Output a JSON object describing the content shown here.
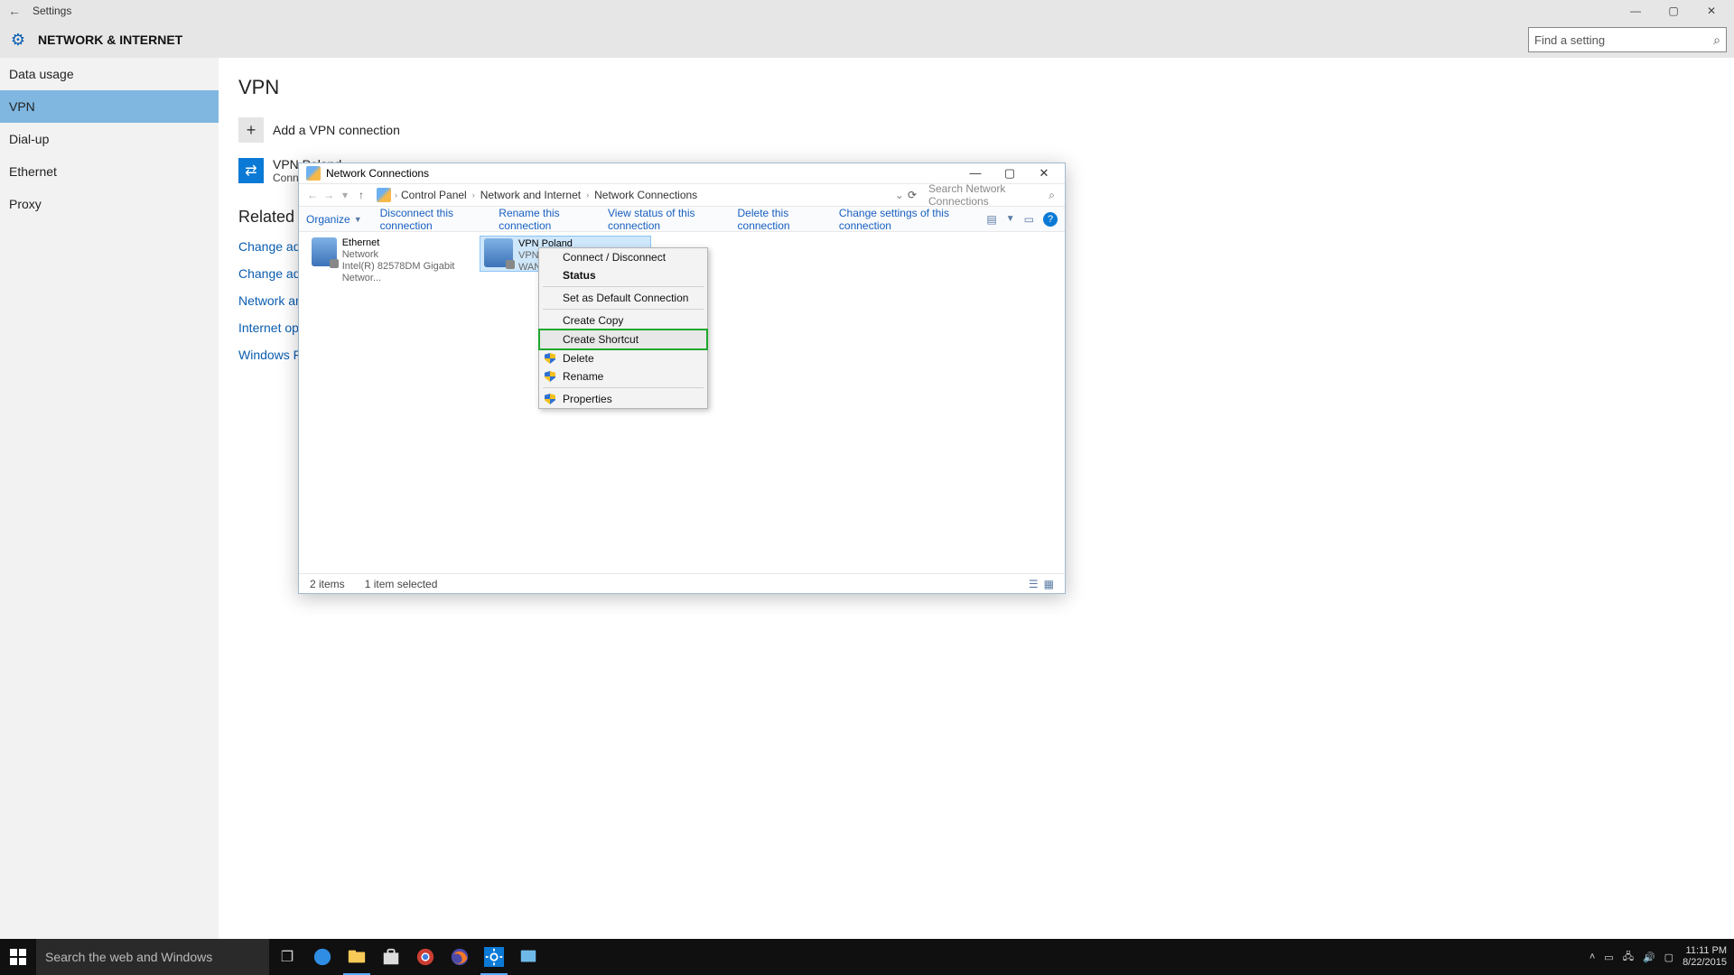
{
  "settings": {
    "title": "Settings",
    "section": "NETWORK & INTERNET",
    "search_placeholder": "Find a setting",
    "sidebar": [
      "Data usage",
      "VPN",
      "Dial-up",
      "Ethernet",
      "Proxy"
    ],
    "sidebar_selected": 1,
    "page_title": "VPN",
    "add_label": "Add a VPN connection",
    "vpn_item": {
      "name": "VPN Poland",
      "status": "Conne"
    },
    "related_heading": "Related s",
    "links": [
      "Change adap",
      "Change advar",
      "Network and",
      "Internet optic",
      "Windows Fire"
    ]
  },
  "nc": {
    "title": "Network Connections",
    "breadcrumbs": [
      "Control Panel",
      "Network and Internet",
      "Network Connections"
    ],
    "search_placeholder": "Search Network Connections",
    "toolbar": {
      "organize": "Organize",
      "items": [
        "Disconnect this connection",
        "Rename this connection",
        "View status of this connection",
        "Delete this connection",
        "Change settings of this connection"
      ]
    },
    "items": [
      {
        "name": "Ethernet",
        "l2": "Network",
        "l3": "Intel(R) 82578DM Gigabit Networ..."
      },
      {
        "name": "VPN Poland",
        "l2": "VPN E",
        "l3": "WAN"
      }
    ],
    "status": {
      "count": "2 items",
      "selected": "1 item selected"
    }
  },
  "context_menu": {
    "items": [
      {
        "label": "Connect / Disconnect"
      },
      {
        "label": "Status",
        "bold": true
      },
      {
        "label": "Set as Default Connection",
        "sep_before": true
      },
      {
        "label": "Create Copy",
        "sep_before": true
      },
      {
        "label": "Create Shortcut",
        "highlight": true
      },
      {
        "label": "Delete",
        "shield": true
      },
      {
        "label": "Rename",
        "shield": true
      },
      {
        "label": "Properties",
        "shield": true,
        "sep_before": true
      }
    ]
  },
  "taskbar": {
    "search_placeholder": "Search the web and Windows",
    "time": "11:11 PM",
    "date": "8/22/2015"
  }
}
